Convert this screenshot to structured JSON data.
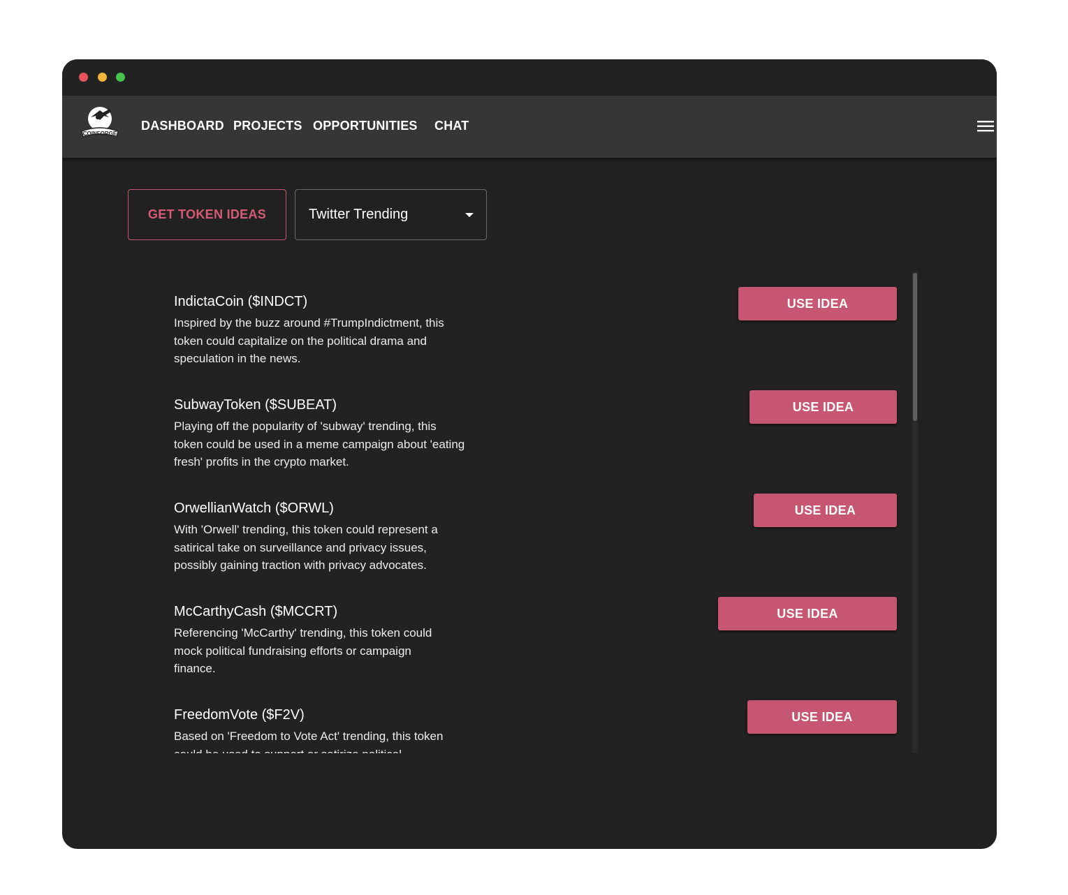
{
  "nav": {
    "logo_alt": "COINFORGE",
    "items": [
      {
        "label": "DASHBOARD"
      },
      {
        "label": "PROJECTS"
      },
      {
        "label": "OPPORTUNITIES"
      },
      {
        "label": "CHAT"
      }
    ],
    "menu_icon": "hamburger-menu-icon"
  },
  "toolbar": {
    "get_ideas_label": "GET TOKEN IDEAS",
    "source_select_value": "Twitter Trending"
  },
  "ideas": [
    {
      "title": "IndictaCoin ($INDCT)",
      "description": "Inspired by the buzz around #TrumpIndictment, this token could capitalize on the political drama and speculation in the news.",
      "button": "USE IDEA"
    },
    {
      "title": "SubwayToken ($SUBEAT)",
      "description": "Playing off the popularity of 'subway' trending, this token could be used in a meme campaign about 'eating fresh' profits in the crypto market.",
      "button": "USE IDEA"
    },
    {
      "title": "OrwellianWatch ($ORWL)",
      "description": "With 'Orwell' trending, this token could represent a satirical take on surveillance and privacy issues, possibly gaining traction with privacy advocates.",
      "button": "USE IDEA"
    },
    {
      "title": "McCarthyCash ($MCCRT)",
      "description": "Referencing 'McCarthy' trending, this token could mock political fundraising efforts or campaign finance.",
      "button": "USE IDEA"
    },
    {
      "title": "FreedomVote ($F2V)",
      "description": "Based on 'Freedom to Vote Act' trending, this token could be used to support or satirize political",
      "button": "USE IDEA"
    }
  ],
  "colors": {
    "accent": "#c75672",
    "window_bg": "#212121",
    "appbar_bg": "#363636"
  }
}
